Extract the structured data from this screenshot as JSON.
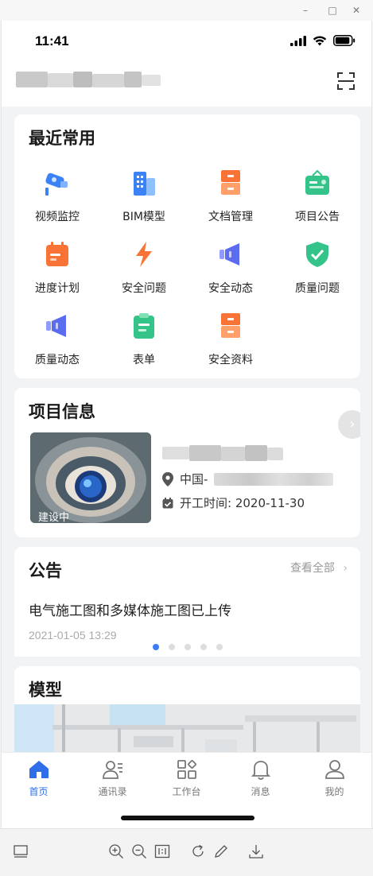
{
  "window": {
    "minimize_glyph": "–",
    "maximize_glyph": "□",
    "close_glyph": "✕"
  },
  "status_bar": {
    "time": "11:41"
  },
  "header": {
    "scan_icon": "scan-icon"
  },
  "recent": {
    "title": "最近常用",
    "items": [
      {
        "label": "视频监控",
        "icon": "camera-icon",
        "color": "#3b82f6"
      },
      {
        "label": "BIM模型",
        "icon": "building-icon",
        "color": "#3b82f6"
      },
      {
        "label": "文档管理",
        "icon": "cabinet-icon",
        "color": "#f97336"
      },
      {
        "label": "项目公告",
        "icon": "badge-icon",
        "color": "#34c48a"
      },
      {
        "label": "进度计划",
        "icon": "calendar-icon",
        "color": "#f97336"
      },
      {
        "label": "安全问题",
        "icon": "lightning-icon",
        "color": "#f97336"
      },
      {
        "label": "安全动态",
        "icon": "speaker-icon",
        "color": "#5b6cf0"
      },
      {
        "label": "质量问题",
        "icon": "shield-check-icon",
        "color": "#34c48a"
      },
      {
        "label": "质量动态",
        "icon": "speaker-icon",
        "color": "#5b6cf0"
      },
      {
        "label": "表单",
        "icon": "clipboard-icon",
        "color": "#34c48a"
      },
      {
        "label": "安全资料",
        "icon": "cabinet-icon",
        "color": "#f97336"
      }
    ]
  },
  "project": {
    "title": "项目信息",
    "status_badge": "建设中",
    "location": "中国-",
    "start_date": "开工时间: 2020-11-30"
  },
  "notice": {
    "title": "公告",
    "view_all": "查看全部",
    "item_text": "电气施工图和多媒体施工图已上传",
    "item_time": "2021-01-05 13:29",
    "page_count": 5,
    "active_page": 1
  },
  "model": {
    "title": "模型"
  },
  "tabs": [
    {
      "label": "首页",
      "icon": "home-icon",
      "active": true
    },
    {
      "label": "通讯录",
      "icon": "contacts-icon",
      "active": false
    },
    {
      "label": "工作台",
      "icon": "apps-icon",
      "active": false
    },
    {
      "label": "消息",
      "icon": "bell-icon",
      "active": false
    },
    {
      "label": "我的",
      "icon": "user-icon",
      "active": false
    }
  ],
  "toolbar": [
    "device-icon",
    "zoom-in-icon",
    "zoom-out-icon",
    "actual-size-icon",
    "rotate-icon",
    "edit-icon",
    "download-icon"
  ],
  "colors": {
    "accent": "#2f6ee8",
    "dot_inactive": "#dddddd"
  }
}
